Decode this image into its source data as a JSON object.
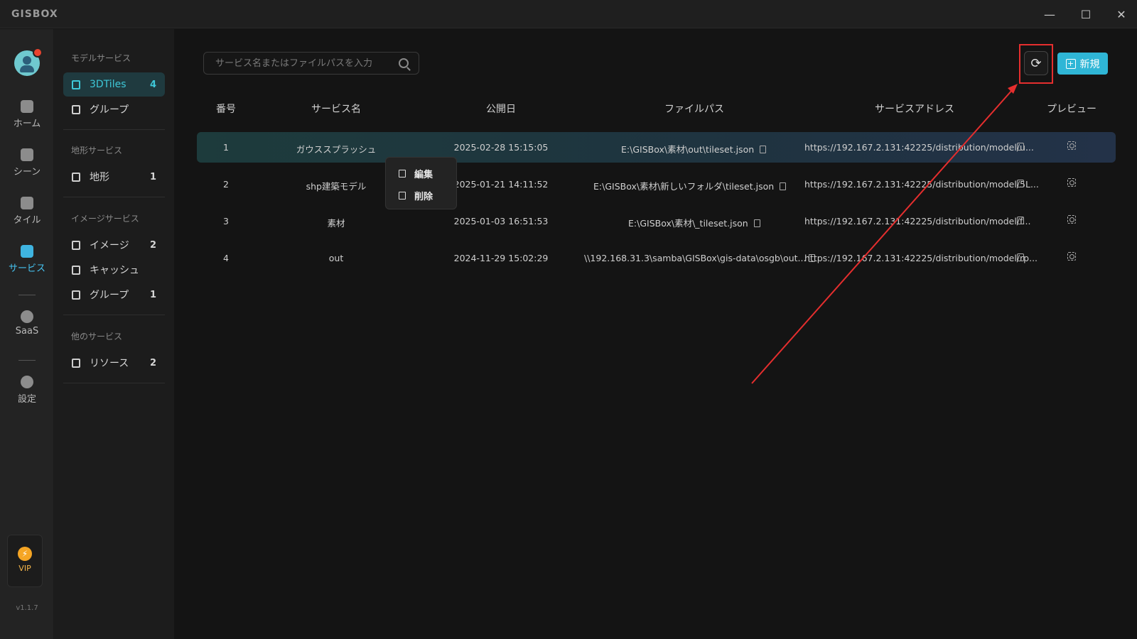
{
  "app": {
    "logo": "GISBOX"
  },
  "window": {
    "minimize": "—",
    "maximize": "☐",
    "close": "✕"
  },
  "rail": {
    "items": [
      {
        "label": "ホーム",
        "icon": "home-icon"
      },
      {
        "label": "シーン",
        "icon": "scene-icon"
      },
      {
        "label": "タイル",
        "icon": "tile-icon"
      },
      {
        "label": "サービス",
        "icon": "service-icon",
        "active": true
      },
      {
        "label": "SaaS",
        "icon": "saas-icon"
      },
      {
        "label": "設定",
        "icon": "settings-icon"
      }
    ],
    "vip": "VIP",
    "version": "v1.1.7"
  },
  "sidebar": {
    "groups": [
      {
        "title": "モデルサービス",
        "items": [
          {
            "label": "3DTiles",
            "count": "4",
            "active": true
          },
          {
            "label": "グループ",
            "count": ""
          }
        ]
      },
      {
        "title": "地形サービス",
        "items": [
          {
            "label": "地形",
            "count": "1"
          }
        ]
      },
      {
        "title": "イメージサービス",
        "items": [
          {
            "label": "イメージ",
            "count": "2"
          },
          {
            "label": "キャッシュ",
            "count": ""
          },
          {
            "label": "グループ",
            "count": "1"
          }
        ]
      },
      {
        "title": "他のサービス",
        "items": [
          {
            "label": "リソース",
            "count": "2"
          }
        ]
      }
    ]
  },
  "toolbar": {
    "search_placeholder": "サービス名またはファイルパスを入力",
    "new_label": "新規"
  },
  "table": {
    "headers": [
      "番号",
      "サービス名",
      "公開日",
      "ファイルパス",
      "サービスアドレス",
      "プレビュー"
    ],
    "rows": [
      {
        "no": "1",
        "name": "ガウススプラッシュ",
        "date": "2025-02-28 15:15:05",
        "path": "E:\\GISBox\\素材\\out\\tileset.json",
        "address": "https://192.167.2.131:42225/distribution/model/u..."
      },
      {
        "no": "2",
        "name": "shp建築モデル",
        "date": "2025-01-21 14:11:52",
        "path": "E:\\GISBox\\素材\\新しいフォルダ\\tileset.json",
        "address": "https://192.167.2.131:42225/distribution/model/5L..."
      },
      {
        "no": "3",
        "name": "素材",
        "date": "2025-01-03 16:51:53",
        "path": "E:\\GISBox\\素材\\_tileset.json",
        "address": "https://192.167.2.131:42225/distribution/model/f..."
      },
      {
        "no": "4",
        "name": "out",
        "date": "2024-11-29 15:02:29",
        "path": "\\\\192.168.31.3\\samba\\GISBox\\gis-data\\osgb\\out...",
        "address": "https://192.167.2.131:42225/distribution/model/rp..."
      }
    ]
  },
  "context_menu": {
    "edit": "編集",
    "delete": "削除"
  },
  "colors": {
    "accent": "#2fb6d6",
    "highlight": "#e52e2e",
    "active_text": "#3ec8d8"
  }
}
